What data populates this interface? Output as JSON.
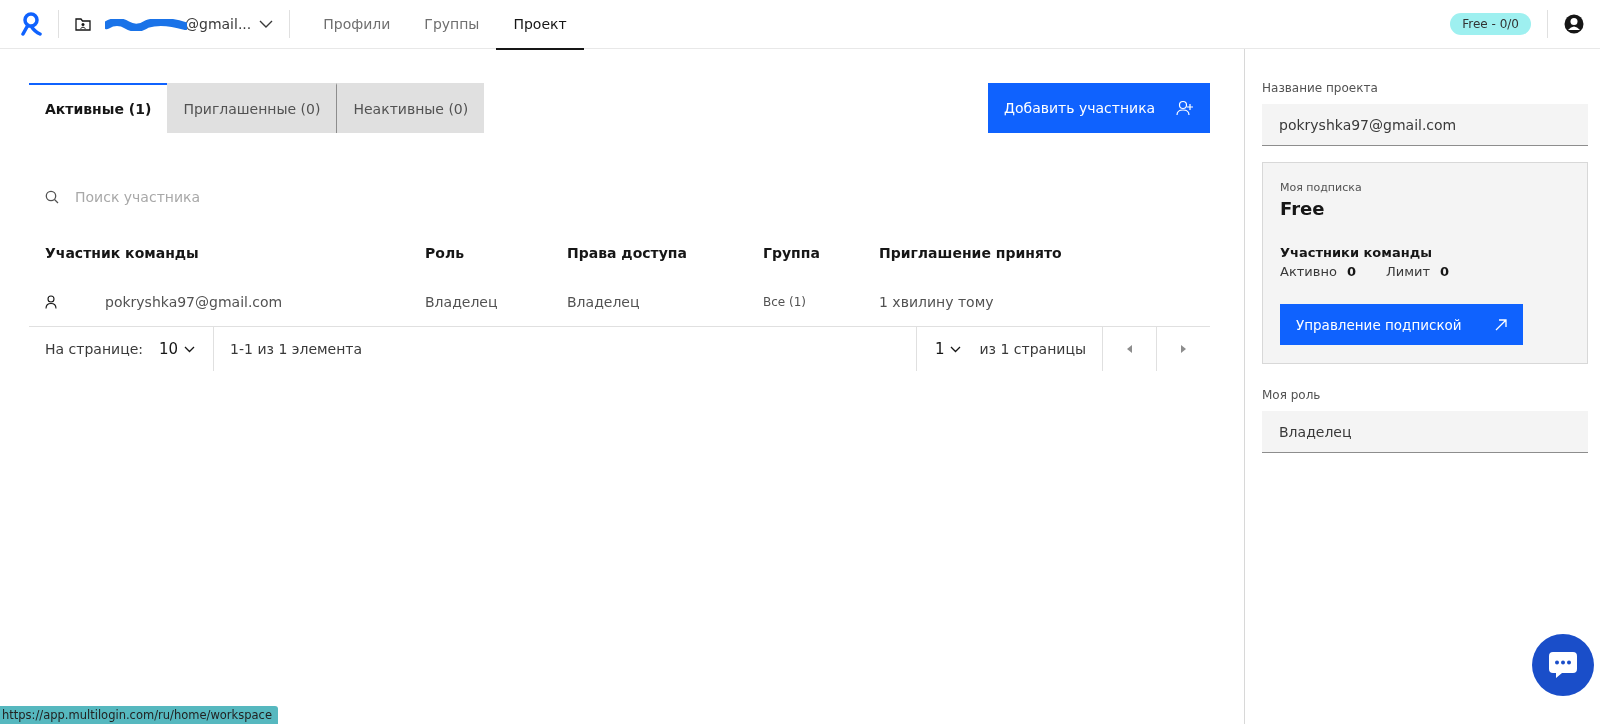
{
  "topbar": {
    "workspace": "@gmail...",
    "nav": [
      {
        "label": "Профили",
        "selected": false
      },
      {
        "label": "Группы",
        "selected": false
      },
      {
        "label": "Проект",
        "selected": true
      }
    ],
    "plan_badge": "Free - 0/0"
  },
  "tabs": [
    {
      "label": "Активные (1)",
      "selected": true
    },
    {
      "label": "Приглашенные (0)",
      "selected": false
    },
    {
      "label": "Неактивные (0)",
      "selected": false
    }
  ],
  "add_button": "Добавить участника",
  "search": {
    "placeholder": "Поиск участника"
  },
  "table": {
    "columns": [
      "Участник команды",
      "Роль",
      "Права доступа",
      "Группа",
      "Приглашение принято"
    ],
    "rows": [
      {
        "member": "pokryshka97@gmail.com",
        "role": "Владелец",
        "access": "Владелец",
        "group": "Все (1)",
        "accepted": "1 хвилину тому"
      }
    ]
  },
  "pagination": {
    "per_page_label": "На странице:",
    "per_page": "10",
    "range": "1-1 из 1 элемента",
    "page": "1",
    "of_pages": "из 1 страницы"
  },
  "sidebar": {
    "project_label": "Название проекта",
    "project_name": "pokryshka97@gmail.com",
    "subscription": {
      "label": "Моя подписка",
      "plan": "Free",
      "members_title": "Участники команды",
      "active_label": "Активно",
      "active": "0",
      "limit_label": "Лимит",
      "limit": "0",
      "button": "Управление подпиской"
    },
    "role_label": "Моя роль",
    "role": "Владелец"
  },
  "status_url": "https://app.multilogin.com/ru/home/workspace"
}
